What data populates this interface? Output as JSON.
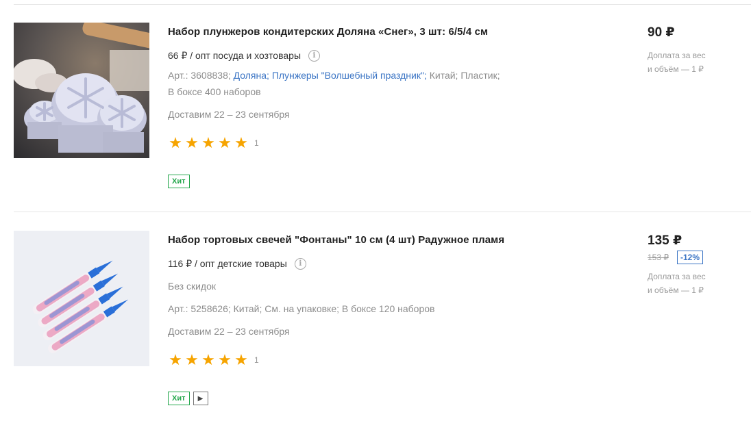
{
  "products": [
    {
      "title": "Набор плунжеров кондитерских Доляна «Снег», 3 шт: 6/5/4 см",
      "wholesale": "66 ₽ / опт посуда и хозтовары",
      "art": "Арт.: 3608838;",
      "brand": "Доляна;",
      "series": "Плунжеры \"Волшебный праздник\";",
      "attrs_tail": "Китай; Пластик;",
      "box": "В боксе 400 наборов",
      "delivery": "Доставим 22 – 23 сентября",
      "rating_value": 5,
      "review_count": "1",
      "badge": "Хит",
      "price": "90 ₽",
      "extra_line1": "Доплата за вес",
      "extra_line2": "и объём — 1 ₽"
    },
    {
      "title": "Набор тортовых свечей \"Фонтаны\" 10 см (4 шт) Радужное пламя",
      "wholesale": "116 ₽ / опт детские товары",
      "no_discount": "Без скидок",
      "attrs": "Арт.: 5258626; Китай; См. на упаковке; В боксе 120 наборов",
      "delivery": "Доставим 22 – 23 сентября",
      "rating_value": 5,
      "review_count": "1",
      "badge": "Хит",
      "price": "135 ₽",
      "old_price": "153 ₽",
      "discount": "-12%",
      "extra_line1": "Доплата за вес",
      "extra_line2": "и объём — 1 ₽"
    }
  ],
  "icons": {
    "info": "info-circle-icon",
    "star": "star-icon",
    "video": "play-icon"
  },
  "colors": {
    "star": "#f6a400",
    "hit_badge": "#22a64a",
    "link": "#3a74c4"
  }
}
